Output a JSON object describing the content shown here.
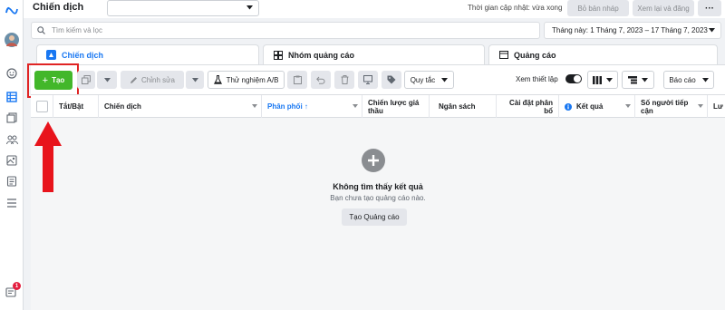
{
  "header": {
    "title": "Chiến dịch",
    "account_value": "",
    "updated_text": "Thời gian cập nhật: vừa xong",
    "draft_button": "Bỏ bản nháp",
    "review_button": "Xem lại và đăng",
    "more_label": "···"
  },
  "search": {
    "placeholder": "Tìm kiếm và lọc"
  },
  "date_range": {
    "label": "Tháng này: 1 Tháng 7, 2023 – 17 Tháng 7, 2023"
  },
  "tabs": [
    {
      "label": "Chiến dịch",
      "icon": "folder-icon",
      "active": true
    },
    {
      "label": "Nhóm quảng cáo",
      "icon": "grid-icon",
      "active": false
    },
    {
      "label": "Quảng cáo",
      "icon": "ad-icon",
      "active": false
    }
  ],
  "toolbar": {
    "create_label": "Tạo",
    "edit_label": "Chỉnh sửa",
    "ab_test_label": "Thử nghiệm A/B",
    "rules_label": "Quy tắc",
    "view_setup_label": "Xem thiết lập",
    "reports_label": "Báo cáo"
  },
  "table": {
    "columns": [
      {
        "label": "Tắt/Bật"
      },
      {
        "label": "Chiến dịch"
      },
      {
        "label": "Phân phối ↑"
      },
      {
        "label": "Chiến lược giá thầu"
      },
      {
        "label": "Ngân sách"
      },
      {
        "label": "Cài đặt phân bổ"
      },
      {
        "label": "Kết quả"
      },
      {
        "label": "Số người tiếp cận"
      },
      {
        "label": "Lư"
      }
    ]
  },
  "empty_state": {
    "title": "Không tìm thấy kết quả",
    "subtitle": "Bạn chưa tạo quảng cáo nào.",
    "button": "Tạo Quảng cáo"
  },
  "notification_badge": "1",
  "colors": {
    "accent": "#1877f2",
    "create_green": "#42b72a",
    "highlight_red": "#e02424"
  }
}
